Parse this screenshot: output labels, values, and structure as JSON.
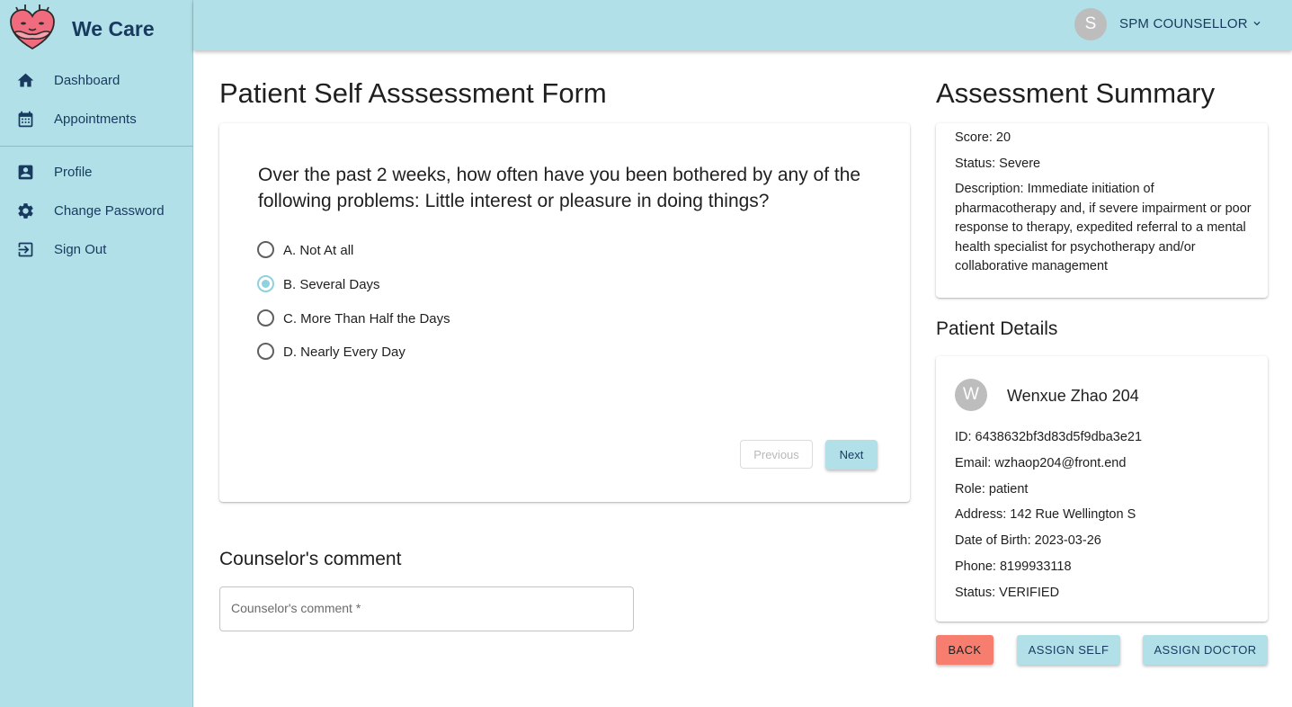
{
  "brand": {
    "name": "We Care"
  },
  "sidebar": {
    "items": [
      {
        "label": "Dashboard",
        "icon": "home-icon"
      },
      {
        "label": "Appointments",
        "icon": "calendar-icon"
      },
      {
        "label": "Profile",
        "icon": "account-box-icon"
      },
      {
        "label": "Change Password",
        "icon": "gear-icon"
      },
      {
        "label": "Sign Out",
        "icon": "logout-icon"
      }
    ]
  },
  "topbar": {
    "avatar_initial": "S",
    "user_name": "SPM COUNSELLOR"
  },
  "form": {
    "title": "Patient Self Asssessment Form",
    "question": "Over the past 2 weeks, how often have you been bothered by any of the following problems: Little interest or pleasure in doing things?",
    "options": [
      {
        "label": "A. Not At all",
        "checked": false
      },
      {
        "label": "B. Several Days",
        "checked": true
      },
      {
        "label": "C. More Than Half the Days",
        "checked": false
      },
      {
        "label": "D. Nearly Every Day",
        "checked": false
      }
    ],
    "previous_label": "Previous",
    "next_label": "Next"
  },
  "comment": {
    "title": "Counselor's comment",
    "placeholder": "Counselor's comment *"
  },
  "summary": {
    "title": "Assessment Summary",
    "score": "Score: 20",
    "status": "Status: Severe",
    "description": "Description: Immediate initiation of pharmacotherapy and, if severe impairment or poor response to therapy, expedited referral to a mental health specialist for psychotherapy and/or collaborative management"
  },
  "patient": {
    "title": "Patient Details",
    "avatar_initial": "W",
    "name": "Wenxue Zhao 204",
    "id": "ID: 6438632bf3d83d5f9dba3e21",
    "email": "Email: wzhaop204@front.end",
    "role": "Role: patient",
    "address": "Address: 142 Rue Wellington S",
    "dob": "Date of Birth: 2023-03-26",
    "phone": "Phone: 8199933118",
    "status": "Status: VERIFIED"
  },
  "actions": {
    "back": "BACK",
    "assign_self": "ASSIGN SELF",
    "assign_doctor": "ASSIGN DOCTOR"
  },
  "colors": {
    "primary": "#b2e0e8",
    "back_button": "#f77e6e",
    "radio_selected": "#8dd2dd",
    "navy_text": "#173a5e"
  }
}
